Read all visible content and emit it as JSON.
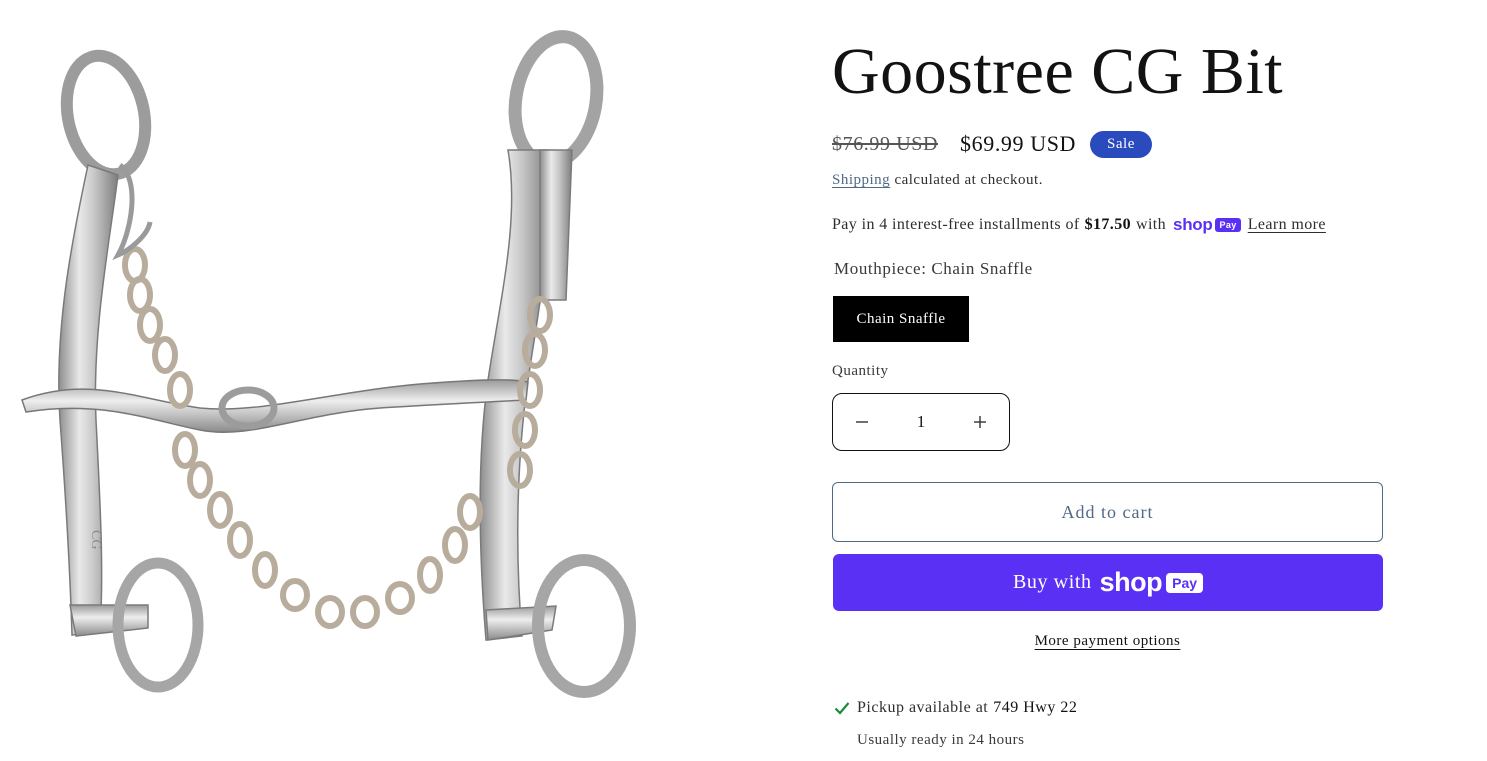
{
  "product": {
    "title": "Goostree CG Bit",
    "image_alt": "Goostree CG Bit with chain snaffle mouthpiece",
    "engraving": "CG"
  },
  "price": {
    "compare_at": "$76.99 USD",
    "sale": "$69.99 USD",
    "badge": "Sale"
  },
  "shipping": {
    "link": "Shipping",
    "text": "calculated at checkout."
  },
  "installments": {
    "prefix": "Pay in 4 interest-free installments of",
    "amount": "$17.50",
    "with": "with",
    "shop_word": "shop",
    "pay_word": "Pay",
    "learn_more": "Learn more"
  },
  "variant": {
    "label": "Mouthpiece: Chain Snaffle",
    "selected": "Chain Snaffle"
  },
  "quantity": {
    "label": "Quantity",
    "value": "1",
    "minus_icon": "minus-icon",
    "plus_icon": "plus-icon"
  },
  "buttons": {
    "add_to_cart": "Add to cart",
    "buy_with": "Buy with",
    "buy_shop": "shop",
    "buy_pay": "Pay",
    "more_payment": "More payment options"
  },
  "pickup": {
    "prefix": "Pickup available at",
    "location": "749 Hwy 22",
    "ready": "Usually ready in 24 hours"
  },
  "colors": {
    "sale_badge": "#2a4bbd",
    "shop_pay": "#5a31f4",
    "accent_link": "#4f6a85",
    "check": "#1a8a3b"
  }
}
